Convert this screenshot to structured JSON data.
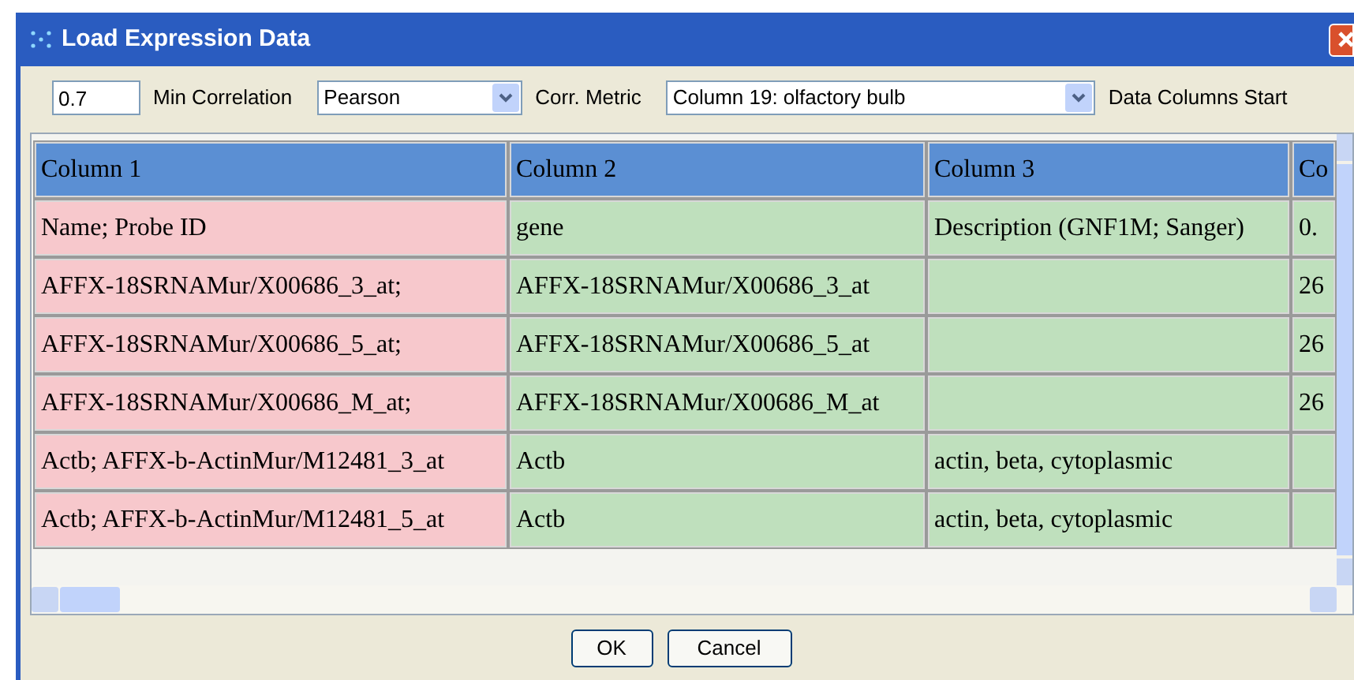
{
  "window": {
    "title": "Load Expression Data"
  },
  "toolbar": {
    "min_correlation": {
      "value": "0.7",
      "label": "Min Correlation"
    },
    "corr_metric": {
      "value": "Pearson",
      "label": "Corr. Metric"
    },
    "data_columns_start": {
      "value": "Column 19: olfactory bulb",
      "label": "Data Columns Start"
    }
  },
  "table": {
    "columns": [
      {
        "label": "Column 1",
        "color": "#f7c8cc"
      },
      {
        "label": "Column 2",
        "color": "#bfe0bd"
      },
      {
        "label": "Column 3",
        "color": "#bfe0bd"
      },
      {
        "label": "Co",
        "color": "#bfe0bd"
      }
    ],
    "rows": [
      [
        "Name; Probe ID",
        "gene",
        "Description (GNF1M; Sanger)",
        "0."
      ],
      [
        "AFFX-18SRNAMur/X00686_3_at;",
        "AFFX-18SRNAMur/X00686_3_at",
        "",
        "26"
      ],
      [
        "AFFX-18SRNAMur/X00686_5_at;",
        "AFFX-18SRNAMur/X00686_5_at",
        "",
        "26"
      ],
      [
        "AFFX-18SRNAMur/X00686_M_at;",
        "AFFX-18SRNAMur/X00686_M_at",
        "",
        "26"
      ],
      [
        "Actb; AFFX-b-ActinMur/M12481_3_at",
        "Actb",
        "actin, beta, cytoplasmic",
        ""
      ],
      [
        "Actb; AFFX-b-ActinMur/M12481_5_at",
        "Actb",
        "actin, beta, cytoplasmic",
        ""
      ]
    ]
  },
  "buttons": [
    "OK",
    "Cancel"
  ]
}
